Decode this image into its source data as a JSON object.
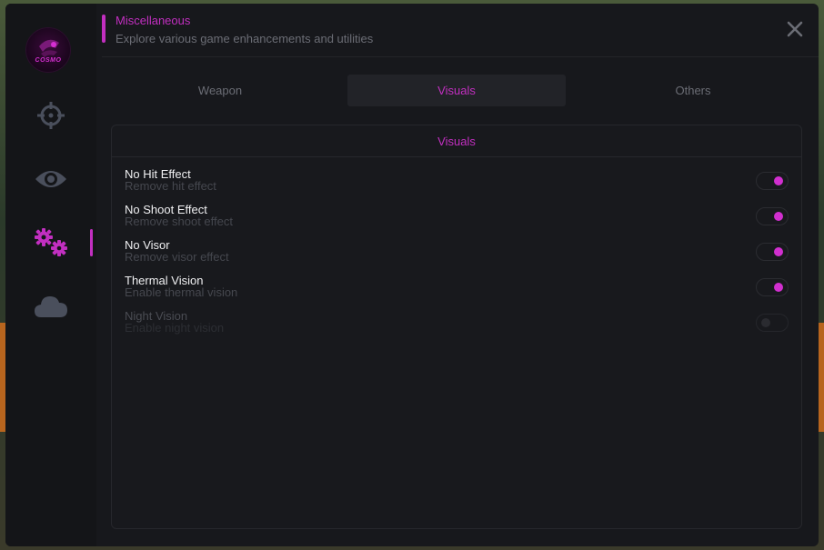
{
  "header": {
    "title": "Miscellaneous",
    "subtitle": "Explore various game enhancements and utilities"
  },
  "logo": {
    "text": "COSMO"
  },
  "sidebar": {
    "items": [
      {
        "icon": "crosshair-icon",
        "active": false
      },
      {
        "icon": "eye-icon",
        "active": false
      },
      {
        "icon": "gears-icon",
        "active": true
      },
      {
        "icon": "cloud-icon",
        "active": false
      }
    ]
  },
  "tabs": [
    {
      "label": "Weapon",
      "active": false
    },
    {
      "label": "Visuals",
      "active": true
    },
    {
      "label": "Others",
      "active": false
    }
  ],
  "panel": {
    "title": "Visuals",
    "options": [
      {
        "title": "No Hit Effect",
        "description": "Remove hit effect",
        "enabled": true,
        "disabled": false
      },
      {
        "title": "No Shoot Effect",
        "description": "Remove shoot effect",
        "enabled": true,
        "disabled": false
      },
      {
        "title": "No Visor",
        "description": "Remove visor effect",
        "enabled": true,
        "disabled": false
      },
      {
        "title": "Thermal Vision",
        "description": "Enable thermal vision",
        "enabled": true,
        "disabled": false
      },
      {
        "title": "Night Vision",
        "description": "Enable night vision",
        "enabled": false,
        "disabled": true
      }
    ]
  },
  "colors": {
    "accent": "#c22fc0",
    "background": "#17181c",
    "sidebar": "#141518",
    "icon_inactive": "#4a4f5c"
  }
}
